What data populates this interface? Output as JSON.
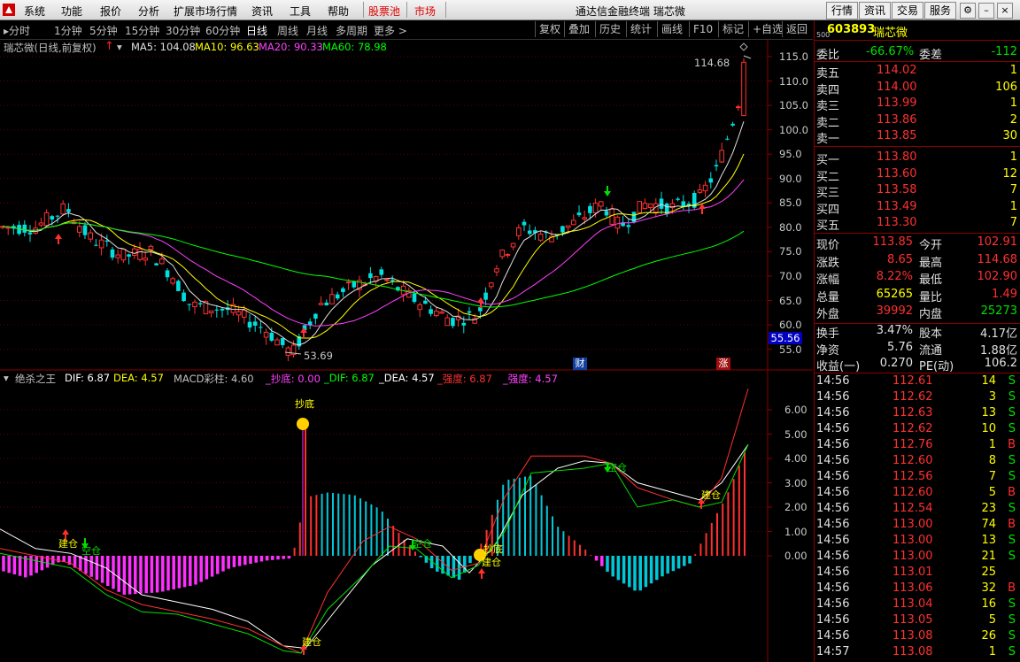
{
  "menu": {
    "items": [
      "系统",
      "功能",
      "报价",
      "分析",
      "扩展市场行情",
      "资讯",
      "工具",
      "帮助"
    ],
    "stock_pool": "股票池",
    "market": "市场",
    "title": "通达信金融终端  瑞芯微",
    "right_tabs": [
      "行情",
      "资讯",
      "交易",
      "服务"
    ]
  },
  "toolbar": {
    "periods": [
      "分时",
      "1分钟",
      "5分钟",
      "15分钟",
      "30分钟",
      "60分钟",
      "日线",
      "周线",
      "月线",
      "多周期",
      "更多"
    ],
    "active": "日线",
    "more_arrow": ">",
    "right_buttons": [
      "复权",
      "叠加",
      "历史",
      "统计",
      "画线",
      "F10",
      "标记",
      "+自选",
      "返回"
    ]
  },
  "main_legend": {
    "name": "瑞芯微(日线,前复权)",
    "ma5": "MA5: 104.08",
    "ma10": "MA10: 96.63",
    "ma20": "MA20: 90.33",
    "ma60": "MA60: 78.98"
  },
  "main_yaxis": [
    "115.0",
    "110.0",
    "105.0",
    "100.0",
    "95.0",
    "90.0",
    "85.0",
    "80.0",
    "75.0",
    "70.0",
    "65.0",
    "60.0",
    "55.0"
  ],
  "current_price_box": "55.56",
  "high_label": "114.68",
  "low_label": "53.69",
  "markers": {
    "cai": "财",
    "zhang": "涨"
  },
  "indicator_legend": {
    "name": "绝杀之王",
    "dif": "DIF: 6.87",
    "dea": "DEA: 4.57",
    "macd": "MACD彩柱: 4.60",
    "chaodi": "_抄底: 0.00",
    "dif2": "_DIF: 6.87",
    "dea2": "_DEA: 4.57",
    "qd1": "_强度: 6.87",
    "qd2": "_强度: 4.57"
  },
  "indicator_yaxis": [
    "6.00",
    "5.00",
    "4.00",
    "3.00",
    "2.00",
    "1.00",
    "0.00"
  ],
  "signals": {
    "build": "建仓",
    "clear": "空仓",
    "bottom": "抄底"
  },
  "quote": {
    "code": "603893",
    "name": "瑞芯微",
    "small": "500",
    "weibi_label": "委比",
    "weibi": "-66.67%",
    "weicha_label": "委差",
    "weicha": "-112",
    "asks": [
      {
        "label": "卖五",
        "price": "114.02",
        "vol": "1"
      },
      {
        "label": "卖四",
        "price": "114.00",
        "vol": "106"
      },
      {
        "label": "卖三",
        "price": "113.99",
        "vol": "1"
      },
      {
        "label": "卖二",
        "price": "113.86",
        "vol": "2"
      },
      {
        "label": "卖一",
        "price": "113.85",
        "vol": "30"
      }
    ],
    "bids": [
      {
        "label": "买一",
        "price": "113.80",
        "vol": "1"
      },
      {
        "label": "买二",
        "price": "113.60",
        "vol": "12"
      },
      {
        "label": "买三",
        "price": "113.58",
        "vol": "7"
      },
      {
        "label": "买四",
        "price": "113.49",
        "vol": "1"
      },
      {
        "label": "买五",
        "price": "113.30",
        "vol": "7"
      }
    ],
    "stats": [
      {
        "l1": "现价",
        "v1": "113.85",
        "l2": "今开",
        "v2": "102.91"
      },
      {
        "l1": "涨跌",
        "v1": "8.65",
        "l2": "最高",
        "v2": "114.68"
      },
      {
        "l1": "涨幅",
        "v1": "8.22%",
        "l2": "最低",
        "v2": "102.90"
      },
      {
        "l1": "总量",
        "v1": "65265",
        "l2": "量比",
        "v2": "1.49"
      },
      {
        "l1": "外盘",
        "v1": "39992",
        "l2": "内盘",
        "v2": "25273"
      }
    ],
    "stats2": [
      {
        "l1": "换手",
        "v1": "3.47%",
        "l2": "股本",
        "v2": "4.17亿"
      },
      {
        "l1": "净资",
        "v1": "5.76",
        "l2": "流通",
        "v2": "1.88亿"
      },
      {
        "l1": "收益(一)",
        "v1": "0.270",
        "l2": "PE(动)",
        "v2": "106.2"
      }
    ],
    "ticks": [
      {
        "t": "14:56",
        "p": "112.61",
        "v": "14",
        "s": "S"
      },
      {
        "t": "14:56",
        "p": "112.62",
        "v": "3",
        "s": "S"
      },
      {
        "t": "14:56",
        "p": "112.63",
        "v": "13",
        "s": "S"
      },
      {
        "t": "14:56",
        "p": "112.62",
        "v": "10",
        "s": "S"
      },
      {
        "t": "14:56",
        "p": "112.76",
        "v": "1",
        "s": "B"
      },
      {
        "t": "14:56",
        "p": "112.60",
        "v": "8",
        "s": "S"
      },
      {
        "t": "14:56",
        "p": "112.56",
        "v": "7",
        "s": "S"
      },
      {
        "t": "14:56",
        "p": "112.60",
        "v": "5",
        "s": "B"
      },
      {
        "t": "14:56",
        "p": "112.54",
        "v": "23",
        "s": "S"
      },
      {
        "t": "14:56",
        "p": "113.00",
        "v": "74",
        "s": "B"
      },
      {
        "t": "14:56",
        "p": "113.00",
        "v": "13",
        "s": "S"
      },
      {
        "t": "14:56",
        "p": "113.00",
        "v": "21",
        "s": "S"
      },
      {
        "t": "14:56",
        "p": "113.01",
        "v": "25",
        "s": ""
      },
      {
        "t": "14:56",
        "p": "113.06",
        "v": "32",
        "s": "B"
      },
      {
        "t": "14:56",
        "p": "113.04",
        "v": "16",
        "s": "S"
      },
      {
        "t": "14:56",
        "p": "113.05",
        "v": "5",
        "s": "S"
      },
      {
        "t": "14:56",
        "p": "113.08",
        "v": "26",
        "s": "S"
      },
      {
        "t": "14:57",
        "p": "113.08",
        "v": "1",
        "s": "S"
      }
    ]
  }
}
